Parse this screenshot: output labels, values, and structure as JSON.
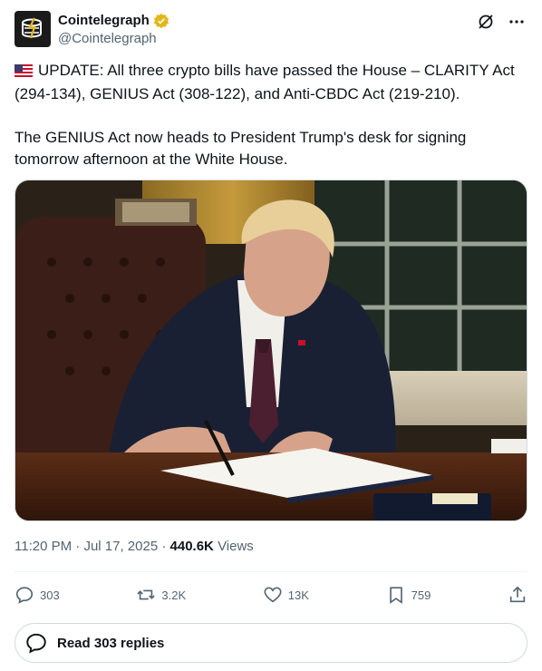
{
  "author": {
    "display_name": "Cointelegraph",
    "handle": "@Cointelegraph",
    "verified": true,
    "badge_color": "#e2b719"
  },
  "tweet": {
    "paragraph1": "UPDATE: All three crypto bills have passed the House – CLARITY Act (294-134), GENIUS Act (308-122), and Anti-CBDC Act (219-210).",
    "paragraph2": "The GENIUS Act now heads to President Trump's desk for signing tomorrow afternoon at the White House.",
    "flag_icon": "us-flag-icon"
  },
  "meta": {
    "time": "11:20 PM",
    "separator": "·",
    "date": "Jul 17, 2025",
    "views_count": "440.6K",
    "views_label": "Views"
  },
  "actions": {
    "replies": "303",
    "reposts": "3.2K",
    "likes": "13K",
    "bookmarks": "759"
  },
  "read_replies_label": "Read 303 replies",
  "colors": {
    "text": "#0f1419",
    "secondary": "#536471",
    "border": "#cfd9de"
  }
}
